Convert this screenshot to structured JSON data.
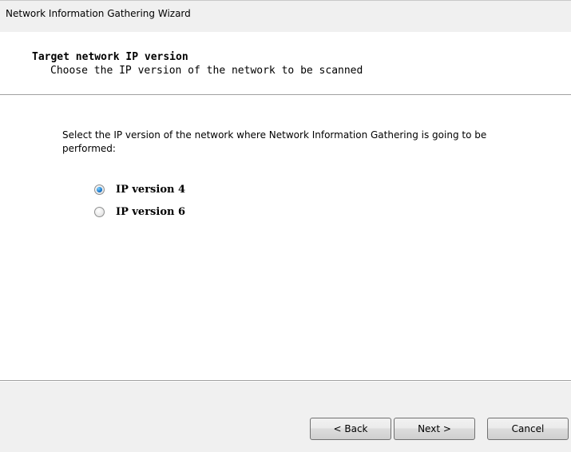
{
  "window": {
    "title": "Network Information Gathering Wizard"
  },
  "header": {
    "title": "Target network IP version",
    "subtitle": "Choose the IP version of the network to be scanned"
  },
  "body": {
    "instruction": "Select the IP version of the network where Network Information Gathering is going to be performed:",
    "options": [
      {
        "label": "IP version 4",
        "checked": true
      },
      {
        "label": "IP version 6",
        "checked": false
      }
    ]
  },
  "footer": {
    "back_label": "< Back",
    "next_label": "Next >",
    "cancel_label": "Cancel"
  }
}
